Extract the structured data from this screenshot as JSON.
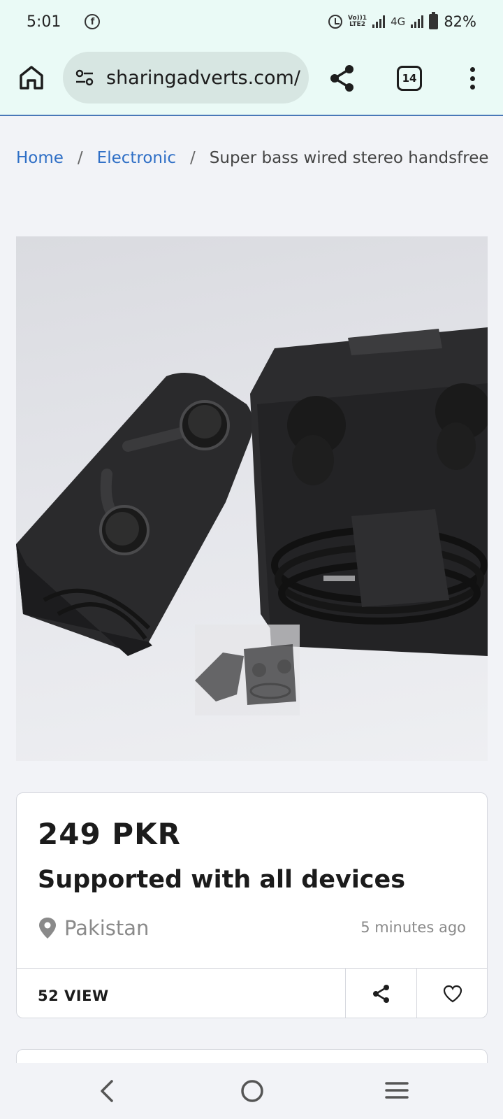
{
  "status_bar": {
    "time": "5:01",
    "network": "4G",
    "volte_line1": "Vo))1",
    "volte_line2": "LTE2",
    "battery": "82%"
  },
  "browser": {
    "url": "sharingadverts.com/",
    "tab_count": "14"
  },
  "breadcrumb": {
    "home": "Home",
    "separator": "/",
    "category": "Electronic",
    "current": "Super bass wired stereo handsfree"
  },
  "listing": {
    "image_subject": "black wired earphones with carrying case",
    "price": "249 PKR",
    "headline": "Supported with all devices",
    "location": "Pakistan",
    "posted": "5 minutes ago",
    "views": "52 VIEW"
  },
  "colors": {
    "link": "#2f6fc6",
    "browser_bg": "#eafaf6",
    "page_bg": "#f2f3f7"
  }
}
